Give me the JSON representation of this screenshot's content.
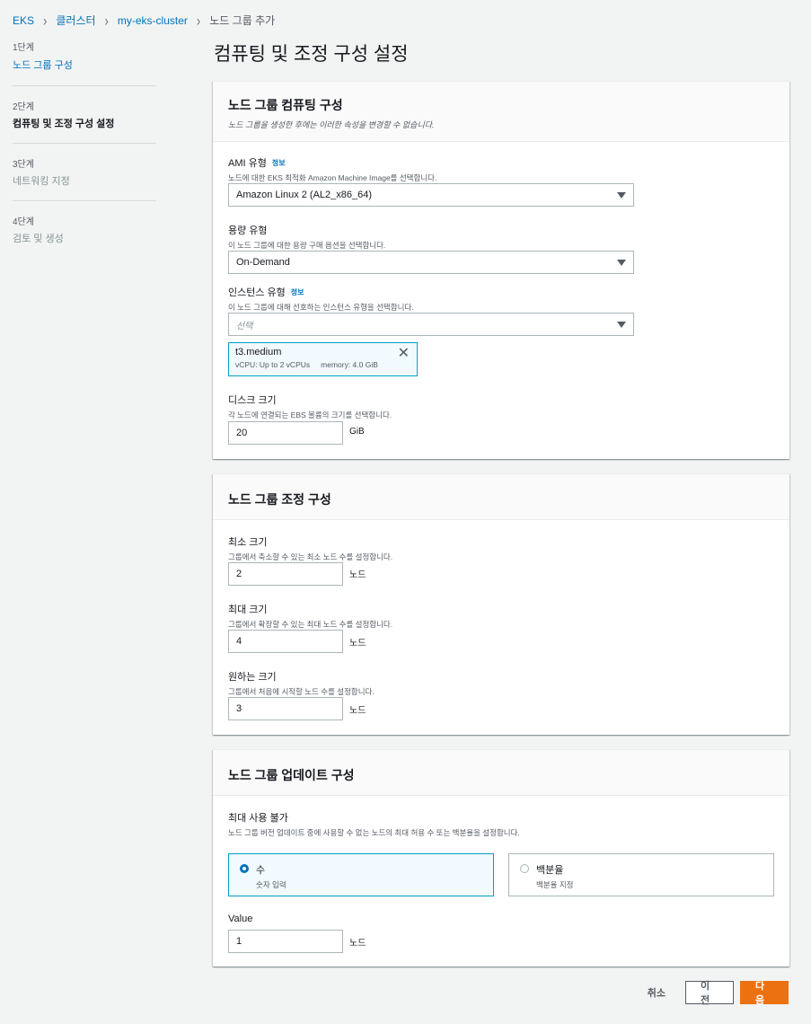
{
  "breadcrumb": [
    "EKS",
    "클러스터",
    "my-eks-cluster",
    "노드 그룹 추가"
  ],
  "steps": [
    {
      "num": "1단계",
      "label": "노드 그룹 구성"
    },
    {
      "num": "2단계",
      "label": "컴퓨팅 및 조정 구성 설정"
    },
    {
      "num": "3단계",
      "label": "네트워킹 지정"
    },
    {
      "num": "4단계",
      "label": "검토 및 생성"
    }
  ],
  "page_title": "컴퓨팅 및 조정 구성 설정",
  "compute": {
    "title": "노드 그룹 컴퓨팅 구성",
    "subtitle": "노드 그룹을 생성한 후에는 이러한 속성을 변경할 수 없습니다.",
    "ami": {
      "label": "AMI 유형",
      "info": "정보",
      "desc": "노드에 대한 EKS 최적화 Amazon Machine Image를 선택합니다.",
      "value": "Amazon Linux 2 (AL2_x86_64)"
    },
    "capacity": {
      "label": "용량 유형",
      "desc": "이 노드 그룹에 대한 용량 구매 옵션을 선택합니다.",
      "value": "On-Demand"
    },
    "instance": {
      "label": "인스턴스 유형",
      "info": "정보",
      "desc": "이 노드 그룹에 대해 선호하는 인스턴스 유형을 선택합니다.",
      "placeholder": "선택",
      "token": {
        "name": "t3.medium",
        "vcpu": "vCPU: Up to 2 vCPUs",
        "memory": "memory: 4.0 GiB"
      }
    },
    "disk": {
      "label": "디스크 크기",
      "desc": "각 노드에 연결되는 EBS 볼륨의 크기를 선택합니다.",
      "value": "20",
      "unit": "GiB"
    }
  },
  "scaling": {
    "title": "노드 그룹 조정 구성",
    "min": {
      "label": "최소 크기",
      "desc": "그룹에서 축소할 수 있는 최소 노드 수를 설정합니다.",
      "value": "2",
      "unit": "노드"
    },
    "max": {
      "label": "최대 크기",
      "desc": "그룹에서 확장할 수 있는 최대 노드 수를 설정합니다.",
      "value": "4",
      "unit": "노드"
    },
    "desired": {
      "label": "원하는 크기",
      "desc": "그룹에서 처음에 시작할 노드 수를 설정합니다.",
      "value": "3",
      "unit": "노드"
    }
  },
  "update": {
    "title": "노드 그룹 업데이트 구성",
    "max_unavailable": {
      "label": "최대 사용 불가",
      "desc": "노드 그룹 버전 업데이트 중에 사용할 수 없는 노드의 최대 허용 수 또는 백분율을 설정합니다."
    },
    "options": [
      {
        "label": "수",
        "desc": "숫자 입력",
        "selected": true
      },
      {
        "label": "백분율",
        "desc": "백분율 지정",
        "selected": false
      }
    ],
    "value": {
      "label": "Value",
      "value": "1",
      "unit": "노드"
    }
  },
  "actions": {
    "cancel": "취소",
    "previous": "이전",
    "next": "다음"
  },
  "colors": {
    "link": "#0073bb",
    "primary": "#ec7211",
    "selected_border": "#00a1c9"
  }
}
